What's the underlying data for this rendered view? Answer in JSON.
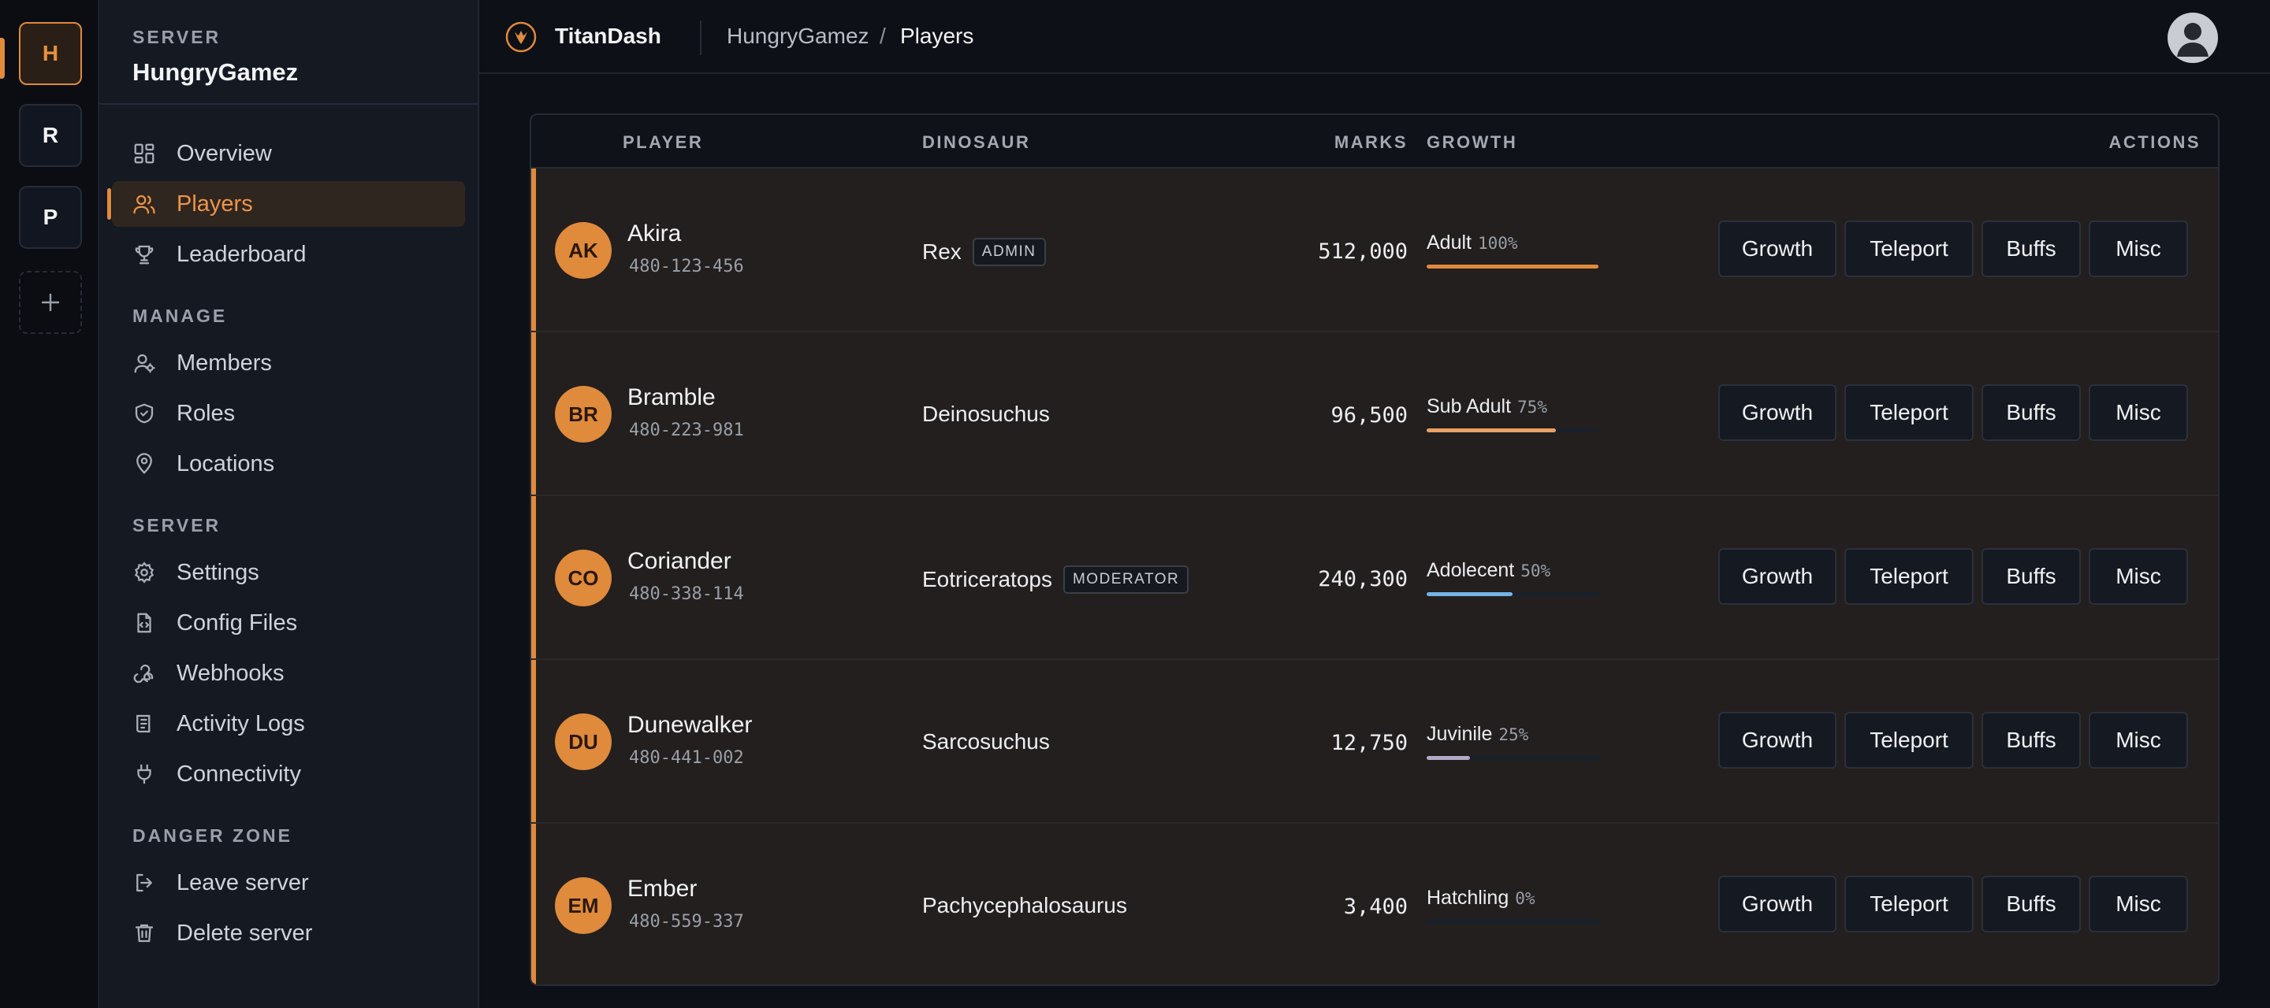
{
  "rail": {
    "servers": [
      {
        "initial": "H",
        "active": true
      },
      {
        "initial": "R",
        "active": false
      },
      {
        "initial": "P",
        "active": false
      }
    ],
    "add_icon": "plus-icon"
  },
  "sidebar": {
    "eyebrow": "SERVER",
    "server_name": "HungryGamez",
    "sections": {
      "manage": "MANAGE",
      "server": "SERVER",
      "danger": "DANGER ZONE"
    },
    "items": [
      {
        "label": "Overview",
        "icon": "dashboard-icon"
      },
      {
        "label": "Players",
        "icon": "users-icon",
        "active": true
      },
      {
        "label": "Leaderboard",
        "icon": "trophy-icon"
      },
      {
        "label": "Members",
        "icon": "member-icon"
      },
      {
        "label": "Roles",
        "icon": "shield-icon"
      },
      {
        "label": "Locations",
        "icon": "map-pin-icon"
      },
      {
        "label": "Settings",
        "icon": "gear-icon"
      },
      {
        "label": "Config Files",
        "icon": "file-code-icon"
      },
      {
        "label": "Webhooks",
        "icon": "webhook-icon"
      },
      {
        "label": "Activity Logs",
        "icon": "log-icon"
      },
      {
        "label": "Connectivity",
        "icon": "plug-icon"
      },
      {
        "label": "Leave server",
        "icon": "logout-icon"
      },
      {
        "label": "Delete server",
        "icon": "trash-icon"
      }
    ]
  },
  "topbar": {
    "brand": "TitanDash",
    "brand_icon": "titan-claw-icon",
    "breadcrumb": [
      "HungryGamez",
      "Players"
    ],
    "separator": "/",
    "account_icon": "user-avatar-icon"
  },
  "table": {
    "columns": {
      "player": "PLAYER",
      "dinosaur": "DINOSAUR",
      "marks": "MARKS",
      "growth": "GROWTH",
      "actions": "ACTIONS"
    },
    "action_labels": [
      "Growth",
      "Teleport",
      "Buffs",
      "Misc"
    ],
    "rows": [
      {
        "initials": "AK",
        "name": "Akira",
        "id": "480-123-456",
        "dinosaur": "Rex",
        "badge": "ADMIN",
        "marks": "512,000",
        "stage": "Adult",
        "pct_label": "100%",
        "pct": 100,
        "color": "#e08a3c"
      },
      {
        "initials": "BR",
        "name": "Bramble",
        "id": "480-223-981",
        "dinosaur": "Deinosuchus",
        "badge": "",
        "marks": "96,500",
        "stage": "Sub Adult",
        "pct_label": "75%",
        "pct": 75,
        "color": "#e8a064"
      },
      {
        "initials": "CO",
        "name": "Coriander",
        "id": "480-338-114",
        "dinosaur": "Eotriceratops",
        "badge": "MODERATOR",
        "marks": "240,300",
        "stage": "Adolecent",
        "pct_label": "50%",
        "pct": 50,
        "color": "#74b3e6"
      },
      {
        "initials": "DU",
        "name": "Dunewalker",
        "id": "480-441-002",
        "dinosaur": "Sarcosuchus",
        "badge": "",
        "marks": "12,750",
        "stage": "Juvinile",
        "pct_label": "25%",
        "pct": 25,
        "color": "#b2a9c6"
      },
      {
        "initials": "EM",
        "name": "Ember",
        "id": "480-559-337",
        "dinosaur": "Pachycephalosaurus",
        "badge": "",
        "marks": "3,400",
        "stage": "Hatchling",
        "pct_label": "0%",
        "pct": 0,
        "color": "#7a8090"
      }
    ]
  }
}
